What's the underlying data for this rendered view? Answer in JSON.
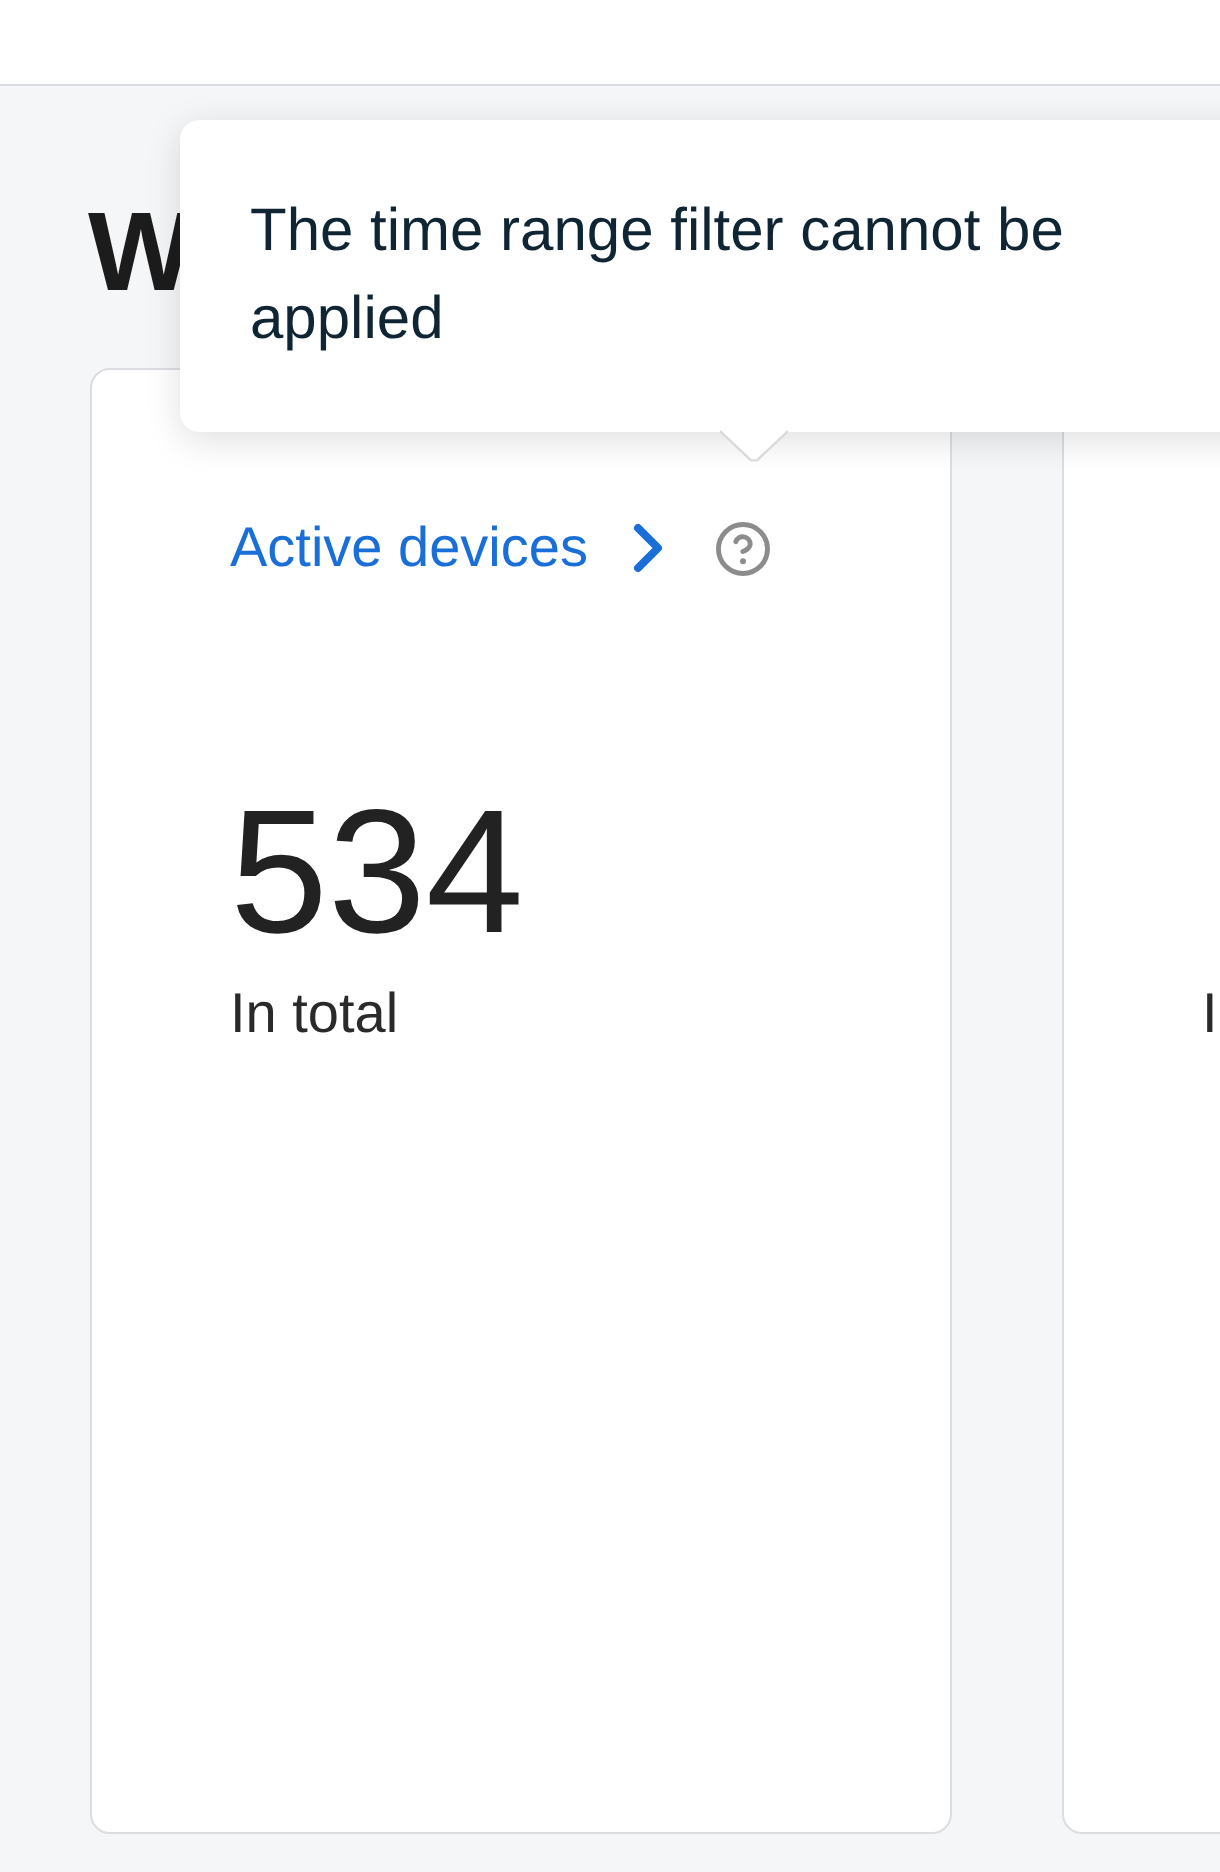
{
  "heading": "W",
  "tooltip": {
    "text": "The time range filter cannot be applied"
  },
  "cards": [
    {
      "link": "Active devices",
      "stats": [
        {
          "value": "534",
          "label": "In total"
        }
      ]
    },
    {
      "stats": [
        {
          "label": "I"
        }
      ]
    }
  ]
}
